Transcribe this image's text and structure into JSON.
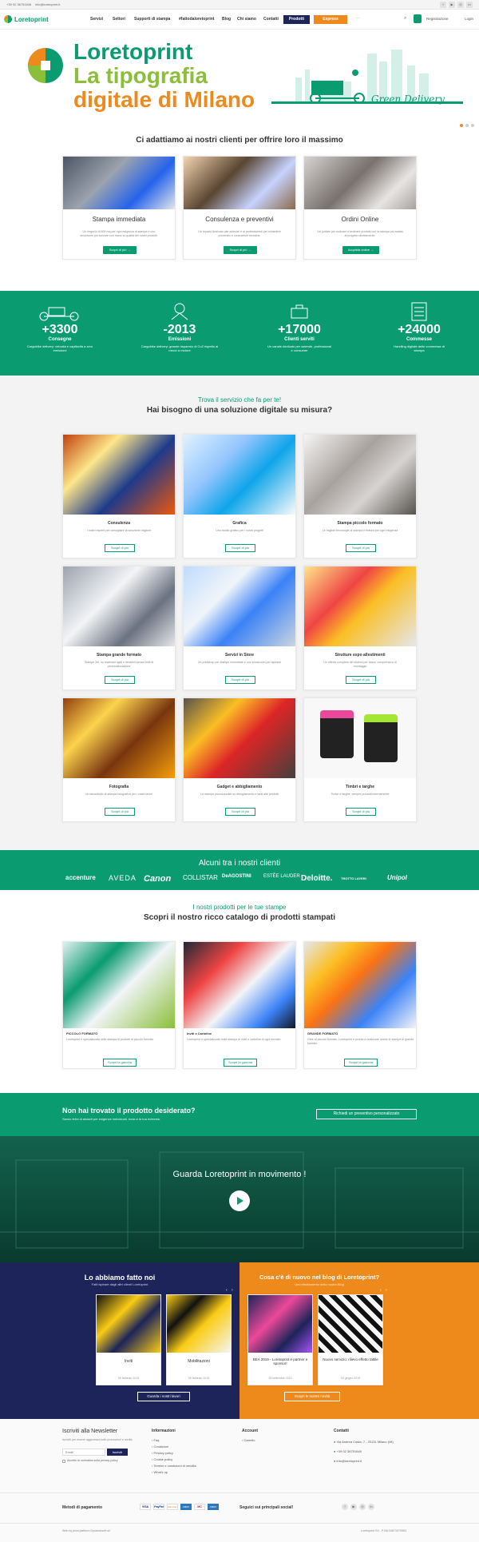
{
  "topbar": {
    "phone": "+39 02 36751646",
    "email": "info@loretoprint.it"
  },
  "brand": {
    "name": "Loretoprint"
  },
  "nav": {
    "items": [
      "Servizi",
      "Settori",
      "Supporti di stampa",
      "#fattodaloretoprint",
      "Blog",
      "Chi siamo",
      "Contatti"
    ],
    "products": "Prodotti",
    "express": "Express",
    "register": "Registrazione",
    "login": "Login",
    "more": "···"
  },
  "hero": {
    "line1": "Loretoprint",
    "line2": "La tipografia",
    "line3": "digitale di Milano",
    "badge": "Green Delivery"
  },
  "intro": {
    "title": "Ci adattiamo ai nostri clienti per offrire loro il massimo",
    "cards": [
      {
        "title": "Stampa immediata",
        "desc": "Un negozio di 600 mq per ogni esigenza di stampa e uno showroom per toccare con mano la qualità dei nostri prodotti.",
        "button": "Scopri di più →"
      },
      {
        "title": "Consulenza e preventivi",
        "desc": "Un reparto dedicato alle aziende e ai professionisti per richiedere preventivi e consulenze tecniche.",
        "button": "Scopri di più →"
      },
      {
        "title": "Ordini Online",
        "desc": "Un portale per ordinare e ordinare prodotti con la stampa più adatta al progetto direttamente.",
        "button": "Acquista online →"
      }
    ]
  },
  "stats": [
    {
      "number": "+3300",
      "label": "Consegne",
      "desc": "Cargobike delivery: velocità e capillarità a zero emissioni"
    },
    {
      "number": "-2013",
      "label": "Emissioni",
      "desc": "Cargobike delivery: grande risparmio di Co2 rispetto ai mezzi a motore"
    },
    {
      "number": "+17000",
      "label": "Clienti serviti",
      "desc": "Un canale dedicato per aziende, professional e consumer"
    },
    {
      "number": "+24000",
      "label": "Commesse",
      "desc": "Handling digitale delle commesse di stampa"
    }
  ],
  "services": {
    "kicker": "Trova il servizio che fa per te!",
    "title": "Hai bisogno di una soluzione digitale su misura?",
    "button": "Scopri di più",
    "items": [
      {
        "title": "Consulenza",
        "desc": "I nostri esperti per consigliare la soluzione migliore"
      },
      {
        "title": "Grafica",
        "desc": "Uno studio grafico per i vostri progetti"
      },
      {
        "title": "Stampa piccolo formato",
        "desc": "Le migliori tecnologie di stampa e finitura per ogni esigenza"
      },
      {
        "title": "Stampa grande formato",
        "desc": "Stampe 3/6, su materiali rigidi e flessibili senza limiti di personalizzazione"
      },
      {
        "title": "Servizi in Store",
        "desc": "Un printshop per stampe immediate e uno showroom per ispirarsi"
      },
      {
        "title": "Strutture expo allestimenti",
        "desc": "Un offerta completa dei sistemi per stand, comprensivo di montaggio"
      },
      {
        "title": "Fotografia",
        "desc": "Un laboratorio di stampa fotografica per i vostri lavori"
      },
      {
        "title": "Gadget e abbigliamento",
        "desc": "La stampa promozionale su abbigliamento e tanti altri prodotti"
      },
      {
        "title": "Timbri e targhe",
        "desc": "Timbri e targhe, sempre prodotti internamente"
      }
    ]
  },
  "clients": {
    "title": "Alcuni tra i nostri clienti",
    "logos": [
      "accenture",
      "AVEDA",
      "Canon",
      "COLLISTAR",
      "DeAGOSTINI",
      "ESTĒE LAUDER",
      "Deloitte.",
      "TROTTO LAYERI",
      "Unipol"
    ]
  },
  "products": {
    "kicker": "I nostri prodotti per le tue stampe",
    "title": "Scopri il nostro ricco catalogo di prodotti stampati",
    "button": "Scopri la gamma",
    "items": [
      {
        "title": "PICCOLO FORMATO",
        "desc": "Loretoprint è specializzata nella stampa di prodotti di piccolo formato"
      },
      {
        "title": "Inviti e Cartoline",
        "desc": "Loretoprint è specializzata nella stampa di inviti e cartoline di ogni formato"
      },
      {
        "title": "GRANDE FORMATO",
        "desc": "Oltre al piccolo formato, Loretoprint è pronta a realizzare anche le stampe di grande formato"
      }
    ]
  },
  "cta": {
    "title": "Non hai trovato il prodotto desiderato?",
    "desc": "Siamo felici di aiutarti per esigenze individuali, invia ci la tua richiesta.",
    "button": "Richiedi un preventivo personalizzato"
  },
  "video": {
    "title": "Guarda Loretoprint in movimento !"
  },
  "works": {
    "title": "Lo abbiamo fatto noi",
    "subtitle": "Fatti ispirare dagli altri clienti Loretoprint",
    "items": [
      {
        "title": "Inviti",
        "date": "08 febbraio 2019"
      },
      {
        "title": "Mobilitazioni",
        "date": "08 febbraio 2019"
      }
    ],
    "button": "Guarda i nostri lavori"
  },
  "blog": {
    "title": "Cosa c'è di nuovo nel blog di Loretoprint?",
    "subtitle": "Uno sfruttamento della nostra Blog",
    "items": [
      {
        "title": "BEA 2019 - Loretoprint è partner e sponsor!",
        "date": "26 settembre 2019"
      },
      {
        "title": "Nuovo servizio: rilievo effetto tattile",
        "date": "03 giugno 2019"
      }
    ],
    "button": "Scopri le nostre novità"
  },
  "footer": {
    "newsletter": {
      "title": "Iscriviti alla Newsletter",
      "desc": "Iscriviti per essere aggiornato sulle promozioni e novità",
      "placeholder": "Email",
      "button": "Iscriviti",
      "privacy": "Accetto la normativa sulla privacy policy"
    },
    "info": {
      "title": "Informazioni",
      "links": [
        "Faq",
        "Condizioni",
        "Privacy policy",
        "Cookie policy",
        "Termini e condizioni di vendita",
        "What's up"
      ]
    },
    "account": {
      "title": "Account",
      "links": [
        "Carrello"
      ]
    },
    "contacts": {
      "title": "Contatti",
      "address": "Via Andrea Costa, 7 - 20131 Milano (MI)",
      "phone": "+39 02 36751646",
      "email": "info@loretoprint.it"
    },
    "payments": {
      "title": "Metodi di pagamento",
      "methods": [
        "VISA",
        "PayPal",
        "discover",
        "AMEX",
        "MC",
        "AMEX"
      ]
    },
    "social": {
      "title": "Seguici sui principali social!"
    },
    "credit": "Web by pixel platform Dynamicsoft srl",
    "vat": "Loretoprint Srl - P.IVA 04871970963"
  },
  "colors": {
    "green": "#0a9b70",
    "navy": "#1c2459",
    "orange": "#ee8a1c",
    "lime": "#8bbf3a"
  }
}
